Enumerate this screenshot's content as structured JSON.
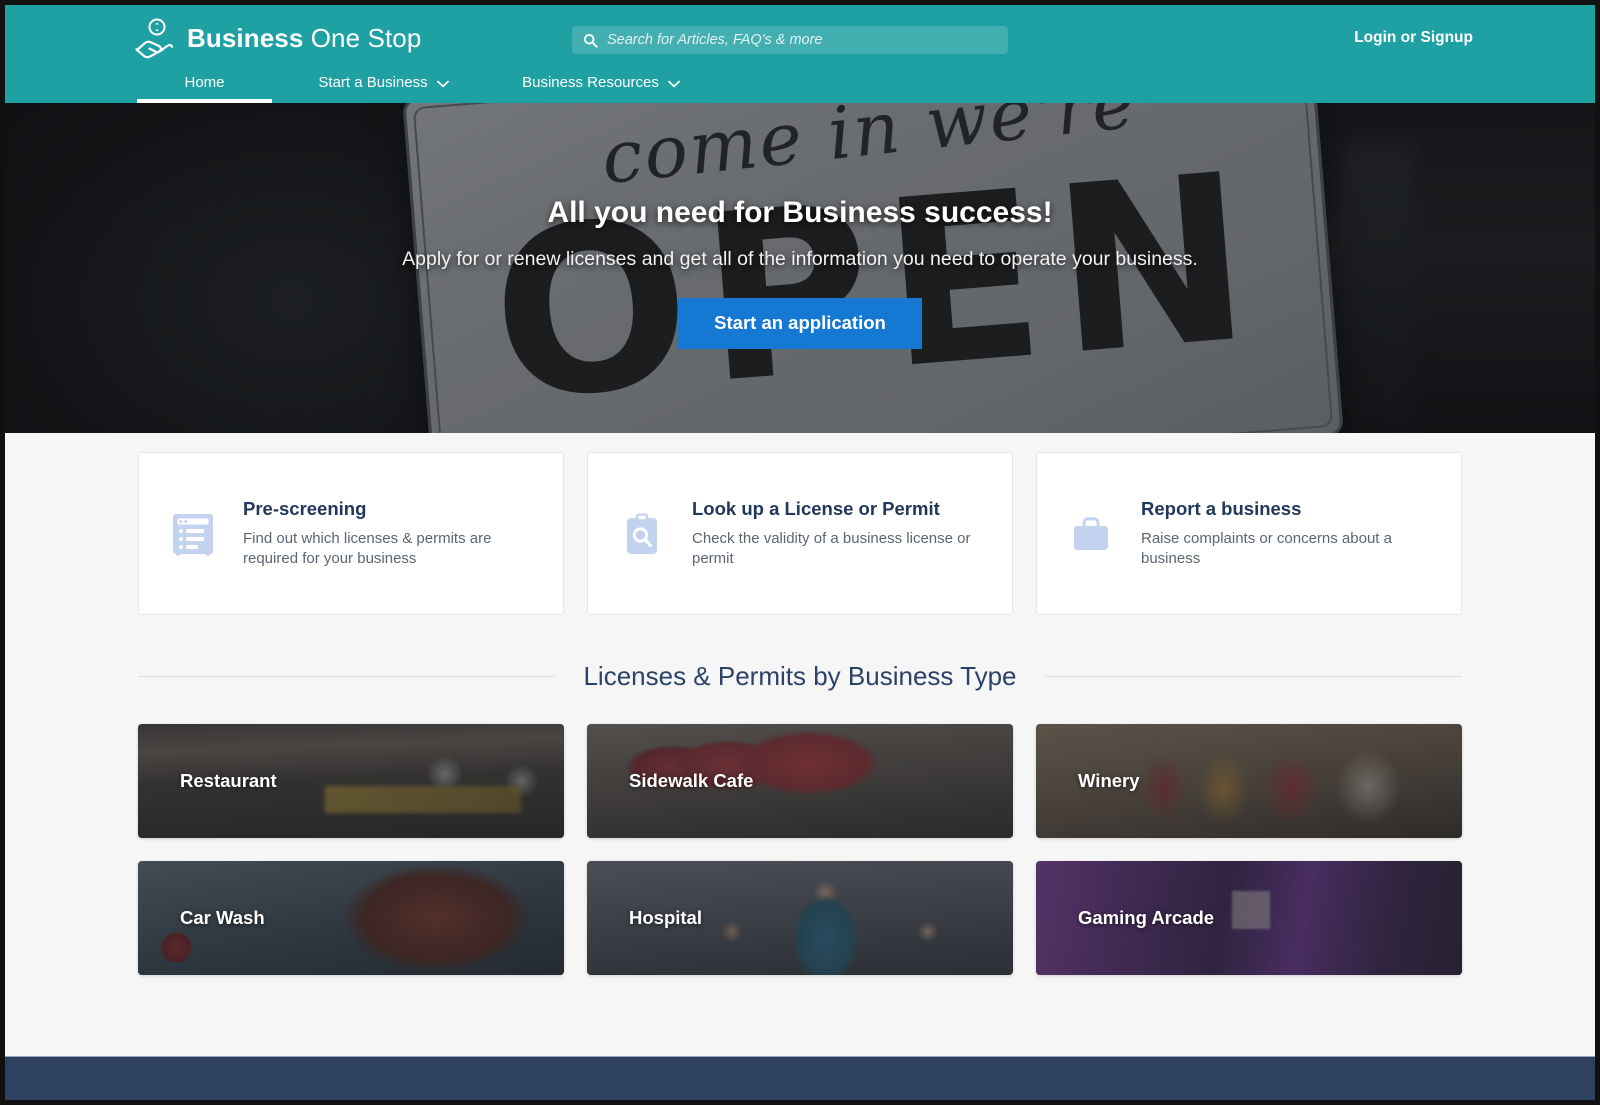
{
  "theme": {
    "teal": "#1fa0a3",
    "accent_blue": "#1578d3",
    "heading_navy": "#21375c",
    "footer_navy": "#2f4161",
    "page_bg": "#f6f6f6",
    "icon_tint": "#c3d2ee"
  },
  "header": {
    "logo_icon": "hand-coin-icon",
    "brand_bold": "Business",
    "brand_light": " One Stop",
    "search": {
      "icon": "search-icon",
      "placeholder": "Search for Articles, FAQ's & more",
      "value": ""
    },
    "login_label": "Login or Signup",
    "nav": [
      {
        "label": "Home",
        "active": true,
        "has_caret": false
      },
      {
        "label": "Start a Business",
        "active": false,
        "has_caret": true,
        "caret_icon": "chevron-down-icon"
      },
      {
        "label": "Business Resources",
        "active": false,
        "has_caret": true,
        "caret_icon": "chevron-down-icon"
      }
    ]
  },
  "hero": {
    "background_image_description": "come in we're OPEN sign hanging in a dark storefront window",
    "sign_text_top": "come in we're",
    "sign_text_main": "OPEN",
    "title": "All you need for Business success!",
    "subtitle": "Apply for or renew licenses and get all of the information you need to operate your business.",
    "button_label": "Start an application"
  },
  "services": [
    {
      "icon": "form-list-icon",
      "title": "Pre-screening",
      "description": "Find out which licenses & permits are required for your business"
    },
    {
      "icon": "clipboard-search-icon",
      "title": "Look up a License or Permit",
      "description": "Check the validity of a business license or permit"
    },
    {
      "icon": "briefcase-icon",
      "title": "Report a business",
      "description": "Raise complaints or concerns about a business"
    }
  ],
  "business_types": {
    "section_title": "Licenses & Permits by Business Type",
    "tiles": [
      {
        "label": "Restaurant",
        "photo": "restaurant-dining-room"
      },
      {
        "label": "Sidewalk Cafe",
        "photo": "red-patio-umbrellas"
      },
      {
        "label": "Winery",
        "photo": "wine-glasses"
      },
      {
        "label": "Car Wash",
        "photo": "car-being-washed"
      },
      {
        "label": "Hospital",
        "photo": "medical-staff"
      },
      {
        "label": "Gaming Arcade",
        "photo": "arcade-machines"
      }
    ]
  },
  "footer": {
    "label": ""
  }
}
